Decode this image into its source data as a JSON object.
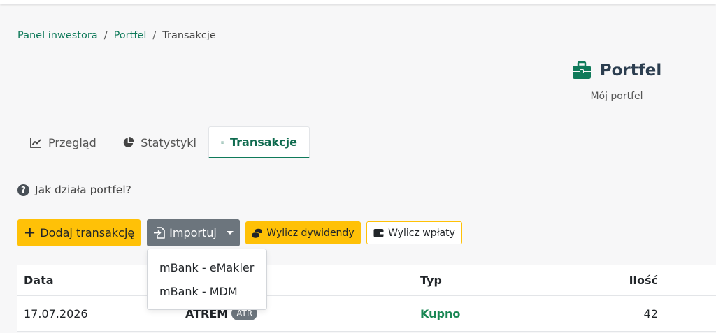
{
  "breadcrumb": {
    "items": [
      "Panel inwestora",
      "Portfel"
    ],
    "current": "Transakcje",
    "separator": "/"
  },
  "header": {
    "icon": "briefcase-icon",
    "title": "Portfel",
    "subtitle": "Mój portfel"
  },
  "tabs": [
    {
      "label": "Przegląd",
      "icon": "line-chart-icon",
      "active": false
    },
    {
      "label": "Statystyki",
      "icon": "pie-chart-icon",
      "active": false
    },
    {
      "label": "Transakcje",
      "icon": "list-icon",
      "active": true
    }
  ],
  "help": {
    "label": "Jak działa portfel?",
    "icon": "question-circle-icon"
  },
  "toolbar": {
    "add_label": "Dodaj transakcję",
    "import_label": "Importuj",
    "dividends_label": "Wylicz dywidendy",
    "deposits_label": "Wylicz wpłaty"
  },
  "import_menu": {
    "items": [
      "mBank - eMakler",
      "mBank - MDM"
    ]
  },
  "table": {
    "columns": [
      "Data",
      "Typ",
      "Ilość"
    ],
    "rows": [
      {
        "date": "17.07.2026",
        "name": "ATREM",
        "ticker": "ATR",
        "type": "Kupno",
        "qty": "42"
      }
    ]
  },
  "colors": {
    "accent": "#0f7a5a",
    "warning": "#ffc107",
    "secondary": "#6c757d",
    "success": "#198754"
  }
}
